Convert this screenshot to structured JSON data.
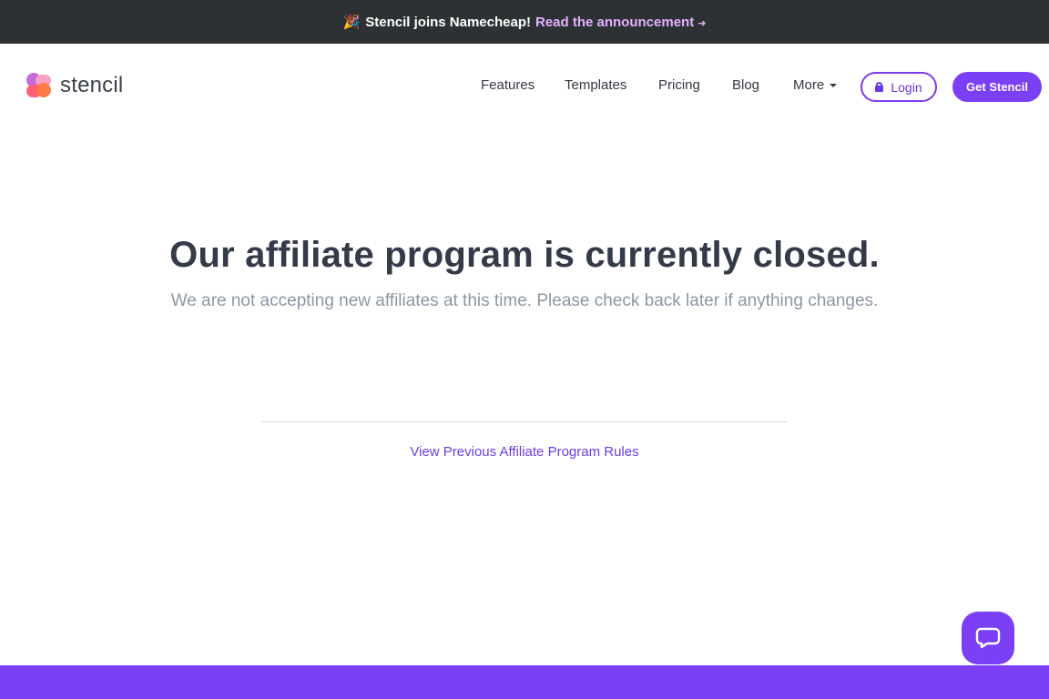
{
  "announcement": {
    "emoji": "🎉",
    "text": "Stencil joins Namecheap!",
    "link_text": "Read the announcement",
    "arrow": "➜"
  },
  "nav": {
    "logo_text": "stencil",
    "items": [
      {
        "label": "Features"
      },
      {
        "label": "Templates"
      },
      {
        "label": "Pricing"
      },
      {
        "label": "Blog"
      },
      {
        "label": "More"
      }
    ],
    "login_label": "Login",
    "cta_label": "Get Stencil"
  },
  "main": {
    "headline": "Our affiliate program is currently closed.",
    "subline": "We are not accepting new affiliates at this time. Please check back later if anything changes.",
    "rules_link": "View Previous Affiliate Program Rules"
  },
  "icons": {
    "chat": "chat-bubble-icon",
    "lock": "lock-icon",
    "more": "caret-down-icon"
  },
  "colors": {
    "brand_purple": "#7b3ff5",
    "announce_bg": "#2e3133",
    "announce_link": "#e2b3ff",
    "headline": "#343a48",
    "subline": "#8d96a4"
  }
}
